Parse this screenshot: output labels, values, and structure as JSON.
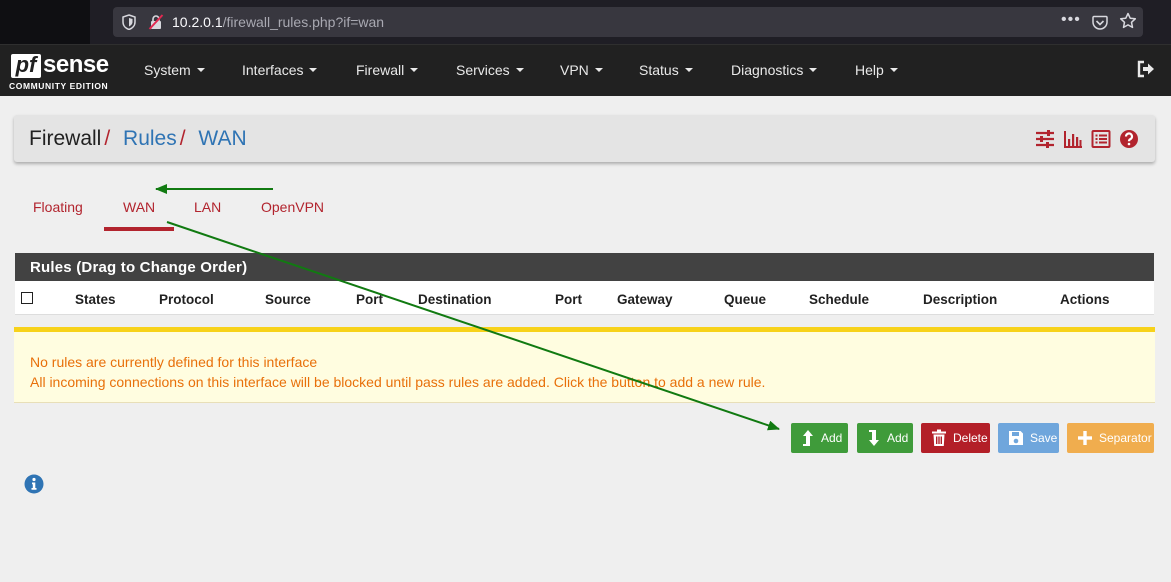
{
  "browser": {
    "url_host": "10.2.0.1",
    "url_path": "/firewall_rules.php?if=wan",
    "menu_dots": "•••"
  },
  "brand": {
    "logo_pf": "pf",
    "logo_sense": "sense",
    "edition": "COMMUNITY EDITION"
  },
  "nav": {
    "items": [
      "System",
      "Interfaces",
      "Firewall",
      "Services",
      "VPN",
      "Status",
      "Diagnostics",
      "Help"
    ]
  },
  "breadcrumb": {
    "root": "Firewall",
    "separator": "/",
    "level2": "Rules",
    "level3": "WAN"
  },
  "tabs": [
    "Floating",
    "WAN",
    "LAN",
    "OpenVPN"
  ],
  "active_tab": "WAN",
  "rules_panel": {
    "title": "Rules (Drag to Change Order)",
    "columns": [
      "States",
      "Protocol",
      "Source",
      "Port",
      "Destination",
      "Port",
      "Gateway",
      "Queue",
      "Schedule",
      "Description",
      "Actions"
    ]
  },
  "notice": {
    "line1": "No rules are currently defined for this interface",
    "line2": "All incoming connections on this interface will be blocked until pass rules are added. Click the button to add a new rule."
  },
  "buttons": {
    "add_top": "Add",
    "add_bottom": "Add",
    "delete": "Delete",
    "save": "Save",
    "separator": "Separator"
  },
  "colors": {
    "accent_red": "#b2242e",
    "link_blue": "#2f74b4",
    "success_green": "#3f9b3a",
    "annotation_arrow": "#117a11"
  }
}
